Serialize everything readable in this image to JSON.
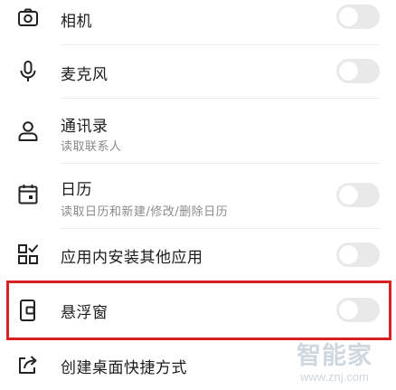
{
  "permissions": [
    {
      "id": "camera",
      "icon": "camera-icon",
      "title": "相机",
      "subtitle": "",
      "toggle_on": false
    },
    {
      "id": "microphone",
      "icon": "microphone-icon",
      "title": "麦克风",
      "subtitle": "",
      "toggle_on": false
    },
    {
      "id": "contacts",
      "icon": "person-icon",
      "title": "通讯录",
      "subtitle": "读取联系人",
      "toggle_on": false
    },
    {
      "id": "calendar",
      "icon": "calendar-icon",
      "title": "日历",
      "subtitle": "读取日历和新建/修改/删除日历",
      "toggle_on": false
    },
    {
      "id": "install-apps",
      "icon": "apps-grid-icon",
      "title": "应用内安装其他应用",
      "subtitle": "",
      "toggle_on": false
    },
    {
      "id": "floating-window",
      "icon": "floating-window-icon",
      "title": "悬浮窗",
      "subtitle": "",
      "toggle_on": false
    },
    {
      "id": "desktop-shortcut",
      "icon": "share-shortcut-icon",
      "title": "创建桌面快捷方式",
      "subtitle": "",
      "toggle_on": null
    }
  ],
  "highlight_color": "#d9201f",
  "toggle_off_color": "#e9e9e9",
  "watermark": {
    "text": "智能家",
    "url": "www.znj.com"
  }
}
